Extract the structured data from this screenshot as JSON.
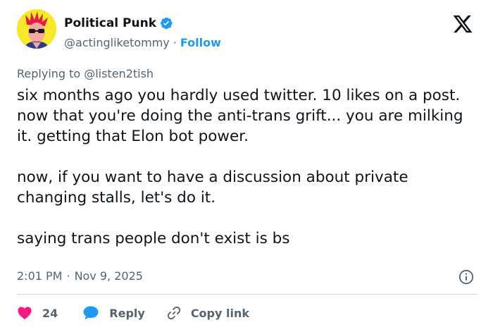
{
  "author": {
    "display_name": "Political Punk",
    "handle": "@actingliketommy",
    "separator": "·",
    "follow_label": "Follow"
  },
  "reply": {
    "prefix": "Replying to",
    "target": "@listen2tish"
  },
  "tweet": {
    "paragraphs": [
      "six months ago you hardly used twitter. 10 likes on a post. now that you're doing the anti-trans grift... you are milking it. getting that Elon bot power.",
      "now, if you want to have a discussion about private changing stalls, let's do it.",
      "saying trans people don't exist is bs"
    ]
  },
  "meta": {
    "time": "2:01 PM",
    "separator": "·",
    "date": "Nov 9, 2025"
  },
  "actions": {
    "like_count": "24",
    "reply_label": "Reply",
    "copy_link_label": "Copy link"
  },
  "colors": {
    "accent": "#1d9bf0",
    "like": "#f91880",
    "text": "#0f1419",
    "secondary": "#536471",
    "avatar_bg": "#f6e928"
  },
  "icons": {
    "verified": "verified-badge-icon",
    "logo": "x-logo-icon",
    "info": "info-icon",
    "like": "heart-icon",
    "reply": "speech-bubble-icon",
    "copy_link": "link-icon"
  }
}
